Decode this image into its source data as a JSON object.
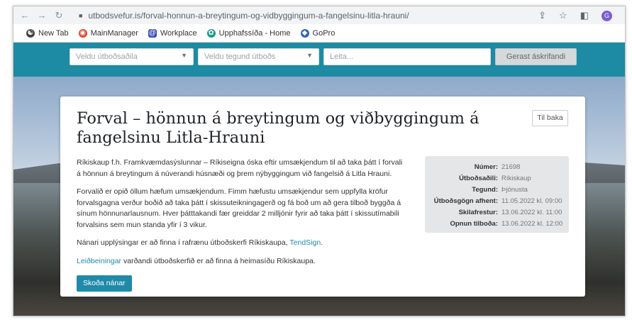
{
  "browser": {
    "url": "utbodsvefur.is/forval-honnun-a-breytingum-og-vidbyggingum-a-fangelsinu-litla-hrauni/",
    "profile_initial": "G",
    "bookmarks": [
      {
        "label": "New Tab",
        "icon": "new-tab-icon",
        "color": "#444444"
      },
      {
        "label": "MainManager",
        "icon": "mainmanager-icon",
        "color": "#e0412b"
      },
      {
        "label": "Workplace",
        "icon": "workplace-icon",
        "color": "#3b4db5"
      },
      {
        "label": "Upphafssíða - Home",
        "icon": "upphafssida-icon",
        "color": "#1b9a8a"
      },
      {
        "label": "GoPro",
        "icon": "gopro-icon",
        "color": "#2a62c9"
      }
    ]
  },
  "header": {
    "owner_select": "Veldu útboðsaðila",
    "type_select": "Veldu tegund útboðs",
    "search_placeholder": "Leita...",
    "subscribe_label": "Gerast áskrifandi",
    "accent": "#1c8ba3"
  },
  "tender": {
    "title": "Forval – hönnun á breytingum og viðbyggingum á fangelsinu Litla-Hrauni",
    "back_label": "Til baka",
    "paragraph1": "Ríkiskaup f.h. Framkvæmdasýslunnar – Ríkiseigna óska eftir umsækjendum til að taka þátt í forvali á hönnun á breytingum á núverandi húsnæði og þrem nýbyggingum við fangelsið á Litla Hrauni.",
    "paragraph2": "Forvalið er opið öllum hæfum umsækjendum. Fimm hæfustu umsækjendur sem uppfylla kröfur forvalsgagna verður boðið að taka þátt í skissuteikningagerð og fá boð um að gera tilboð byggða á sínum hönnunarlausnum. Hver þátttakandi fær greiddar 2 milljónir fyrir að taka þátt í skissutímabili forvalsins sem mun standa yfir í 3 vikur.",
    "paragraph3_text": "Nánari upplýsingar er að finna í rafrænu útboðskerfi Ríkiskaupa, ",
    "paragraph3_link": "TendSign",
    "paragraph3_end": ".",
    "paragraph4_link": "Leiðbeiningar",
    "paragraph4_text": " varðandi útboðskerfið er að finna á heimasíðu Ríkiskaupa.",
    "details_button": "Skoða nánar",
    "info": [
      {
        "key": "Númer:",
        "value": "21698"
      },
      {
        "key": "Útboðsaðili:",
        "value": "Ríkiskaup"
      },
      {
        "key": "Tegund:",
        "value": "Þjónusta"
      },
      {
        "key": "Útboðsgögn afhent:",
        "value": "11.05.2022 kl. 09:00"
      },
      {
        "key": "Skilafrestur:",
        "value": "13.06.2022 kl. 11:00"
      },
      {
        "key": "Opnun tilboða:",
        "value": "13.06.2022 kl. 12:00"
      }
    ]
  }
}
